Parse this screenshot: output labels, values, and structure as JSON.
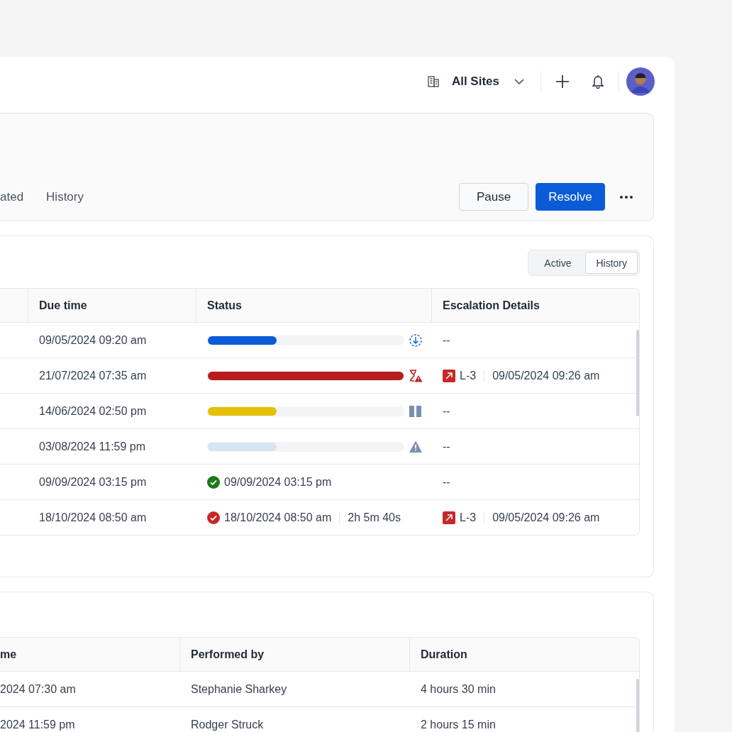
{
  "topbar": {
    "site_label": "All Sites"
  },
  "header": {
    "tabs": [
      {
        "label": "ated",
        "selected": false
      },
      {
        "label": "History",
        "selected": false
      }
    ],
    "buttons": [
      {
        "label": "Pause",
        "kind": "secondary"
      },
      {
        "label": "Resolve",
        "kind": "primary"
      }
    ]
  },
  "sla": {
    "toggle": [
      {
        "label": "Active",
        "selected": false
      },
      {
        "label": "History",
        "selected": true
      }
    ],
    "columns": [
      "",
      "Due time",
      "Status",
      "Escalation Details"
    ],
    "rows": [
      {
        "due": "09/05/2024 09:20 am",
        "status": {
          "kind": "upcoming",
          "level": 0.35,
          "color": "#0b5bd7"
        },
        "escalation": {
          "kind": "none",
          "text": "--"
        }
      },
      {
        "due": "21/07/2024 07:35 am",
        "status": {
          "kind": "breached",
          "level": 1,
          "color": "#b71c1c"
        },
        "escalation": {
          "kind": "escalated",
          "level_text": "L-3",
          "time": "09/05/2024 09:26 am"
        }
      },
      {
        "due": "14/06/2024 02:50 pm",
        "status": {
          "kind": "paused",
          "level": 0.35,
          "color": "#e4c000"
        },
        "escalation": {
          "kind": "none",
          "text": "--"
        }
      },
      {
        "due": "03/08/2024 11:59 pm",
        "status": {
          "kind": "at_risk",
          "level": 0.35,
          "color": "#d8e3f3"
        },
        "escalation": {
          "kind": "none",
          "text": "--"
        }
      },
      {
        "due": "09/09/2024 03:15 pm",
        "status": {
          "kind": "completed",
          "color": "#1b7a1b",
          "date": "09/09/2024 03:15 pm"
        },
        "escalation": {
          "kind": "none",
          "text": "--"
        }
      },
      {
        "due": "18/10/2024 08:50 am",
        "status": {
          "kind": "completed",
          "color": "#c62828",
          "date": "18/10/2024 08:50 am",
          "duration": "2h 5m 40s"
        },
        "escalation": {
          "kind": "escalated",
          "level_text": "L-3",
          "time": "09/05/2024 09:26 am"
        }
      }
    ]
  },
  "history": {
    "columns": [
      "me",
      "Performed by",
      "Duration"
    ],
    "rows": [
      {
        "time": "2024 07:30 am",
        "performed_by": "Stephanie Sharkey",
        "duration": "4 hours 30 min"
      },
      {
        "time": "2024 11:59 pm",
        "performed_by": "Rodger Struck",
        "duration": "2 hours 15 min"
      }
    ]
  }
}
